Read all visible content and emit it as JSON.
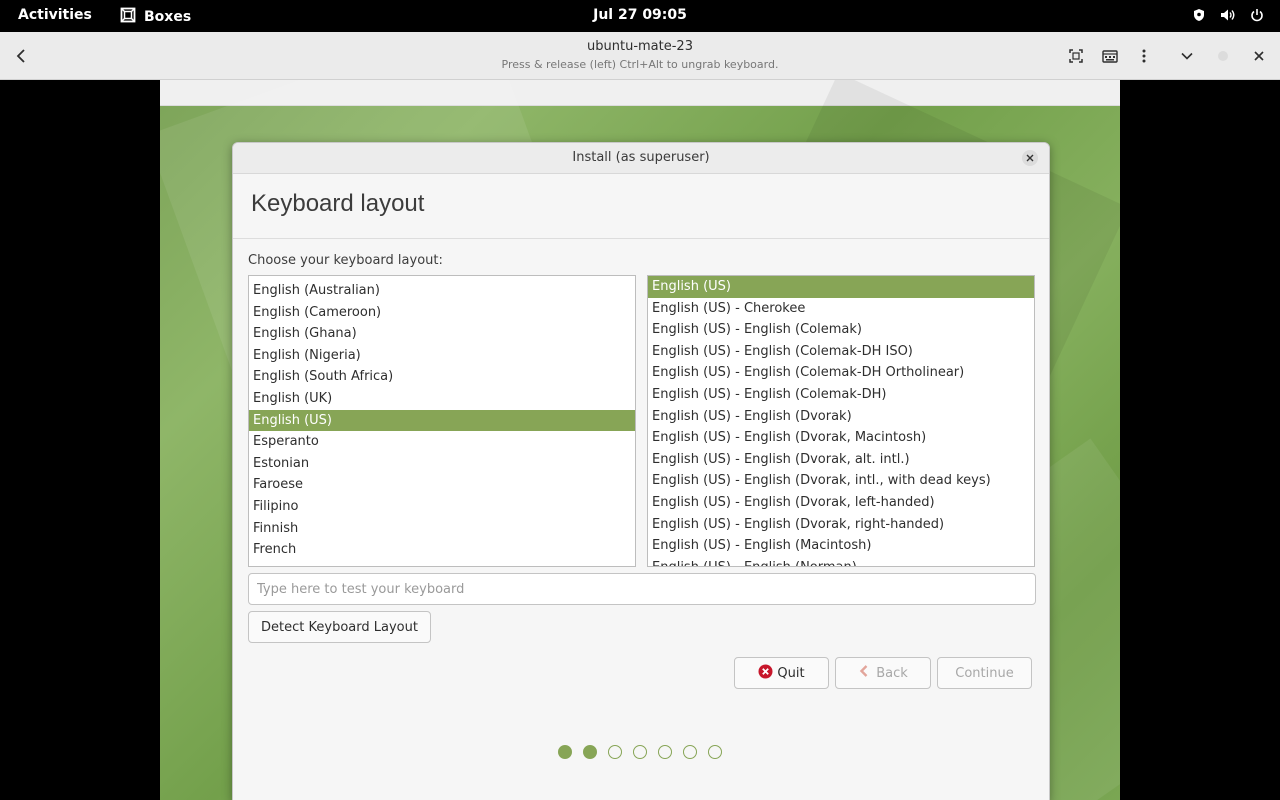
{
  "topbar": {
    "activities": "Activities",
    "app_name": "Boxes",
    "clock": "Jul 27  09:05",
    "icons": [
      "shield-icon",
      "volume-icon",
      "power-icon"
    ]
  },
  "headerbar": {
    "title": "ubuntu-mate-23",
    "subtitle": "Press & release (left) Ctrl+Alt to ungrab keyboard.",
    "icons": [
      "back-icon",
      "fullscreen-icon",
      "keyboard-icon",
      "menu-icon",
      "chevron-down-icon",
      "close-icon"
    ]
  },
  "dialog": {
    "window_title": "Install (as superuser)",
    "heading": "Keyboard layout",
    "prompt": "Choose your keyboard layout:",
    "languages": [
      "English (Australian)",
      "English (Cameroon)",
      "English (Ghana)",
      "English (Nigeria)",
      "English (South Africa)",
      "English (UK)",
      "English (US)",
      "Esperanto",
      "Estonian",
      "Faroese",
      "Filipino",
      "Finnish",
      "French"
    ],
    "selected_language": "English (US)",
    "variants": [
      "English (US)",
      "English (US) - Cherokee",
      "English (US) - English (Colemak)",
      "English (US) - English (Colemak-DH ISO)",
      "English (US) - English (Colemak-DH Ortholinear)",
      "English (US) - English (Colemak-DH)",
      "English (US) - English (Dvorak)",
      "English (US) - English (Dvorak, Macintosh)",
      "English (US) - English (Dvorak, alt. intl.)",
      "English (US) - English (Dvorak, intl., with dead keys)",
      "English (US) - English (Dvorak, left-handed)",
      "English (US) - English (Dvorak, right-handed)",
      "English (US) - English (Macintosh)",
      "English (US) - English (Norman)"
    ],
    "selected_variant": "English (US)",
    "test_placeholder": "Type here to test your keyboard",
    "detect_button": "Detect Keyboard Layout",
    "quit_button": "Quit",
    "back_button": "Back",
    "continue_button": "Continue",
    "progress": {
      "total_steps": 7,
      "completed_steps": 2
    }
  },
  "colors": {
    "accent": "#87a556",
    "quit_icon": "#c7162b"
  }
}
